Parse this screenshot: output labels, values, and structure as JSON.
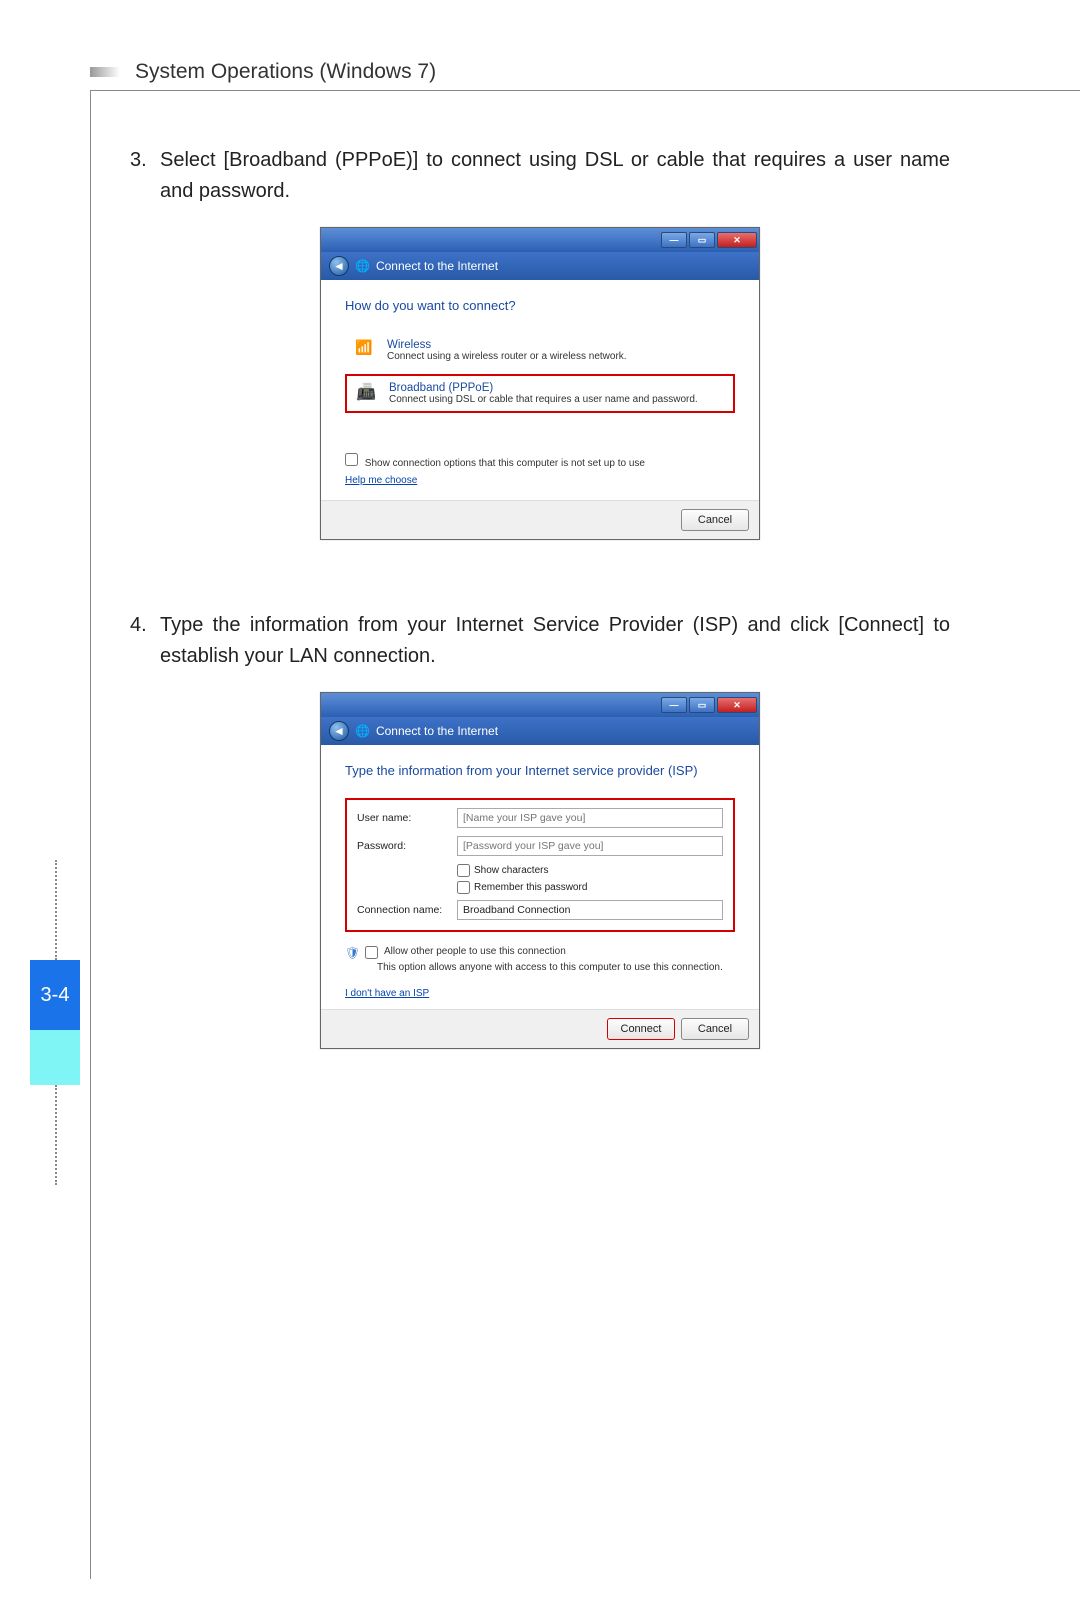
{
  "header": {
    "title": "System Operations (Windows 7)"
  },
  "page_number": "3-4",
  "steps": {
    "s3": {
      "num": "3.",
      "text": "Select [Broadband (PPPoE)] to connect using DSL or cable that requires a user name and password."
    },
    "s4": {
      "num": "4.",
      "text": "Type the information from your Internet Service Provider (ISP) and click [Connect] to establish your LAN connection."
    }
  },
  "dialog1": {
    "window_title": "Connect to the Internet",
    "question": "How do you want to connect?",
    "options": {
      "wireless": {
        "title": "Wireless",
        "desc": "Connect using a wireless router or a wireless network."
      },
      "broadband": {
        "title": "Broadband (PPPoE)",
        "desc": "Connect using DSL or cable that requires a user name and password."
      }
    },
    "show_options_label": "Show connection options that this computer is not set up to use",
    "help_link": "Help me choose",
    "cancel": "Cancel"
  },
  "dialog2": {
    "window_title": "Connect to the Internet",
    "heading": "Type the information from your Internet service provider (ISP)",
    "labels": {
      "username": "User name:",
      "password": "Password:",
      "conn_name": "Connection name:"
    },
    "placeholders": {
      "username": "[Name your ISP gave you]",
      "password": "[Password your ISP gave you]"
    },
    "conn_name_value": "Broadband Connection",
    "show_chars": "Show characters",
    "remember": "Remember this password",
    "allow_others": "Allow other people to use this connection",
    "allow_desc": "This option allows anyone with access to this computer to use this connection.",
    "no_isp_link": "I don't have an ISP",
    "connect": "Connect",
    "cancel": "Cancel"
  }
}
